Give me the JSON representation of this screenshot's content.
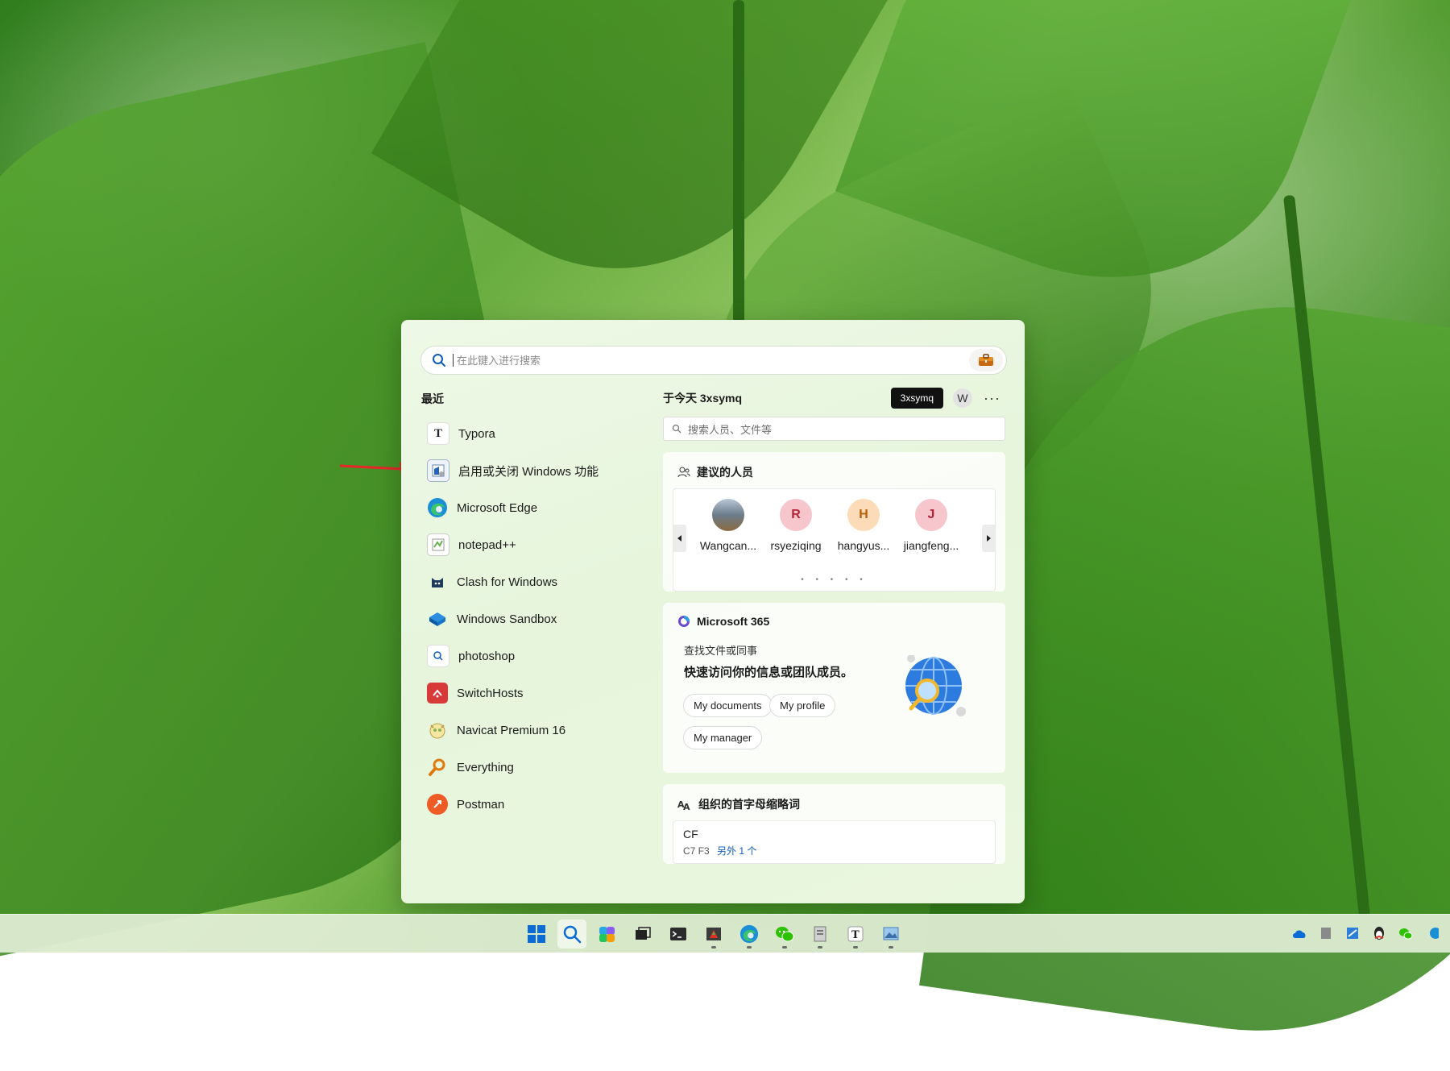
{
  "search": {
    "placeholder": "在此键入进行搜索"
  },
  "recent": {
    "title": "最近",
    "items": [
      {
        "label": "Typora",
        "icon": "typora-icon"
      },
      {
        "label": "启用或关闭 Windows 功能",
        "icon": "windows-features-icon"
      },
      {
        "label": "Microsoft Edge",
        "icon": "edge-icon"
      },
      {
        "label": "notepad++",
        "icon": "notepadpp-icon"
      },
      {
        "label": "Clash for Windows",
        "icon": "clash-icon"
      },
      {
        "label": "Windows Sandbox",
        "icon": "sandbox-icon"
      },
      {
        "label": "photoshop",
        "icon": "search-result-icon"
      },
      {
        "label": "SwitchHosts",
        "icon": "switchhosts-icon"
      },
      {
        "label": "Navicat Premium 16",
        "icon": "navicat-icon"
      },
      {
        "label": "Everything",
        "icon": "everything-icon"
      },
      {
        "label": "Postman",
        "icon": "postman-icon"
      }
    ]
  },
  "right": {
    "header": {
      "title": "于今天 3xsymq",
      "org_pill": "3xsymq",
      "avatar_letter": "W",
      "more": "···"
    },
    "people_search": {
      "placeholder": "搜索人员、文件等"
    },
    "suggested": {
      "title": "建议的人员",
      "people": [
        {
          "initial": "",
          "name": "Wangcan...",
          "bg": "#6b7c8c"
        },
        {
          "initial": "R",
          "name": "rsyeziqing",
          "bg": "#f6c6cc",
          "fg": "#b4233a"
        },
        {
          "initial": "H",
          "name": "hangyus...",
          "bg": "#fcdcb8",
          "fg": "#b35e0b"
        },
        {
          "initial": "J",
          "name": "jiangfeng...",
          "bg": "#f6c6cc",
          "fg": "#b4233a"
        }
      ],
      "dots": "• • • • •"
    },
    "m365": {
      "title": "Microsoft 365",
      "subtitle": "查找文件或同事",
      "headline": "快速访问你的信息或团队成员。",
      "chips": [
        "My documents",
        "My profile",
        "My manager"
      ]
    },
    "org": {
      "title": "组织的首字母缩略词",
      "name": "CF",
      "meta": "C7 F3",
      "more": "另外 1 个"
    }
  },
  "colors": {
    "accent": "#0f5cbe",
    "pill": "#111111",
    "panel_bg": "#e9f6df",
    "annotation": "#e8262a"
  }
}
